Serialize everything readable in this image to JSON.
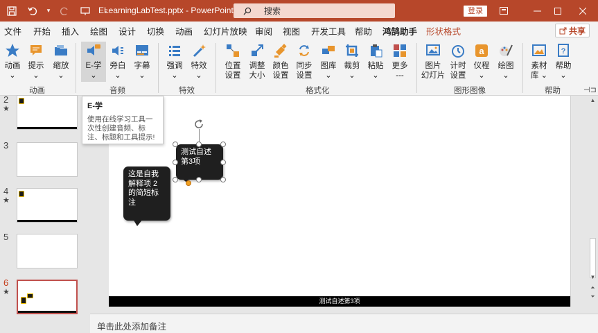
{
  "titlebar": {
    "title": "ELearningLabTest.pptx  -  PowerPoint",
    "search_placeholder": "搜索",
    "login": "登录",
    "colors": {
      "accent": "#b7472a"
    }
  },
  "tabs": [
    "文件",
    "开始",
    "插入",
    "绘图",
    "设计",
    "切换",
    "动画",
    "幻灯片放映",
    "审阅",
    "视图",
    "开发工具",
    "帮助",
    "鸿鹄助手",
    "形状格式"
  ],
  "share": "共享",
  "ribbon": {
    "buttons": [
      {
        "label": "动画",
        "sub": "⌄",
        "icon": "star-icon"
      },
      {
        "label": "提示",
        "sub": "⌄",
        "icon": "comment-icon"
      },
      {
        "label": "缩放",
        "sub": "⌄",
        "icon": "folder-icon"
      },
      {
        "label": "E-学",
        "sub": "⌄",
        "icon": "elearn-icon"
      },
      {
        "label": "旁白",
        "sub": "⌄",
        "icon": "speaker-icon"
      },
      {
        "label": "字幕",
        "sub": "⌄",
        "icon": "subtitle-icon"
      },
      {
        "label": "强调",
        "sub": "⌄",
        "icon": "list-icon"
      },
      {
        "label": "特效",
        "sub": "⌄",
        "icon": "magic-icon"
      },
      {
        "label": "位置",
        "sub": "设置",
        "icon": "position-icon"
      },
      {
        "label": "调整",
        "sub": "大小",
        "icon": "resize-icon"
      },
      {
        "label": "颜色",
        "sub": "设置",
        "icon": "paint-icon"
      },
      {
        "label": "同步",
        "sub": "设置",
        "icon": "sync-icon"
      },
      {
        "label": "图库",
        "sub": "⌄",
        "icon": "gallery-icon"
      },
      {
        "label": "裁剪",
        "sub": "⌄",
        "icon": "crop-icon"
      },
      {
        "label": "粘贴",
        "sub": "⌄",
        "icon": "paste-icon"
      },
      {
        "label": "更多",
        "sub": "---",
        "icon": "more-icon"
      },
      {
        "label": "图片",
        "sub": "幻灯片",
        "icon": "picture-slide-icon"
      },
      {
        "label": "计时",
        "sub": "设置",
        "icon": "timer-icon"
      },
      {
        "label": "仪程",
        "sub": "⌄",
        "icon": "agenda-icon"
      },
      {
        "label": "绘图",
        "sub": "⌄",
        "icon": "draw-icon"
      },
      {
        "label": "素材",
        "sub": "库 ⌄",
        "icon": "material-icon"
      },
      {
        "label": "帮助",
        "sub": "⌄",
        "icon": "help-icon"
      }
    ],
    "groups": [
      "动画",
      "音频",
      "特效",
      "格式化",
      "图形图像",
      "帮助"
    ]
  },
  "tooltip": {
    "title": "E-学",
    "body": "使用在线学习工具一次性创建音频、标注、标题和工具提示!"
  },
  "thumbnails": [
    {
      "num": "2",
      "star": "★"
    },
    {
      "num": "3",
      "star": ""
    },
    {
      "num": "4",
      "star": "★"
    },
    {
      "num": "5",
      "star": ""
    },
    {
      "num": "6",
      "star": "★"
    }
  ],
  "slide": {
    "callout1": "测试自述第3项",
    "callout2": "这是自我解释项 2 的简短标注",
    "footer": "测试自述第3项"
  },
  "notes_placeholder": "单击此处添加备注"
}
